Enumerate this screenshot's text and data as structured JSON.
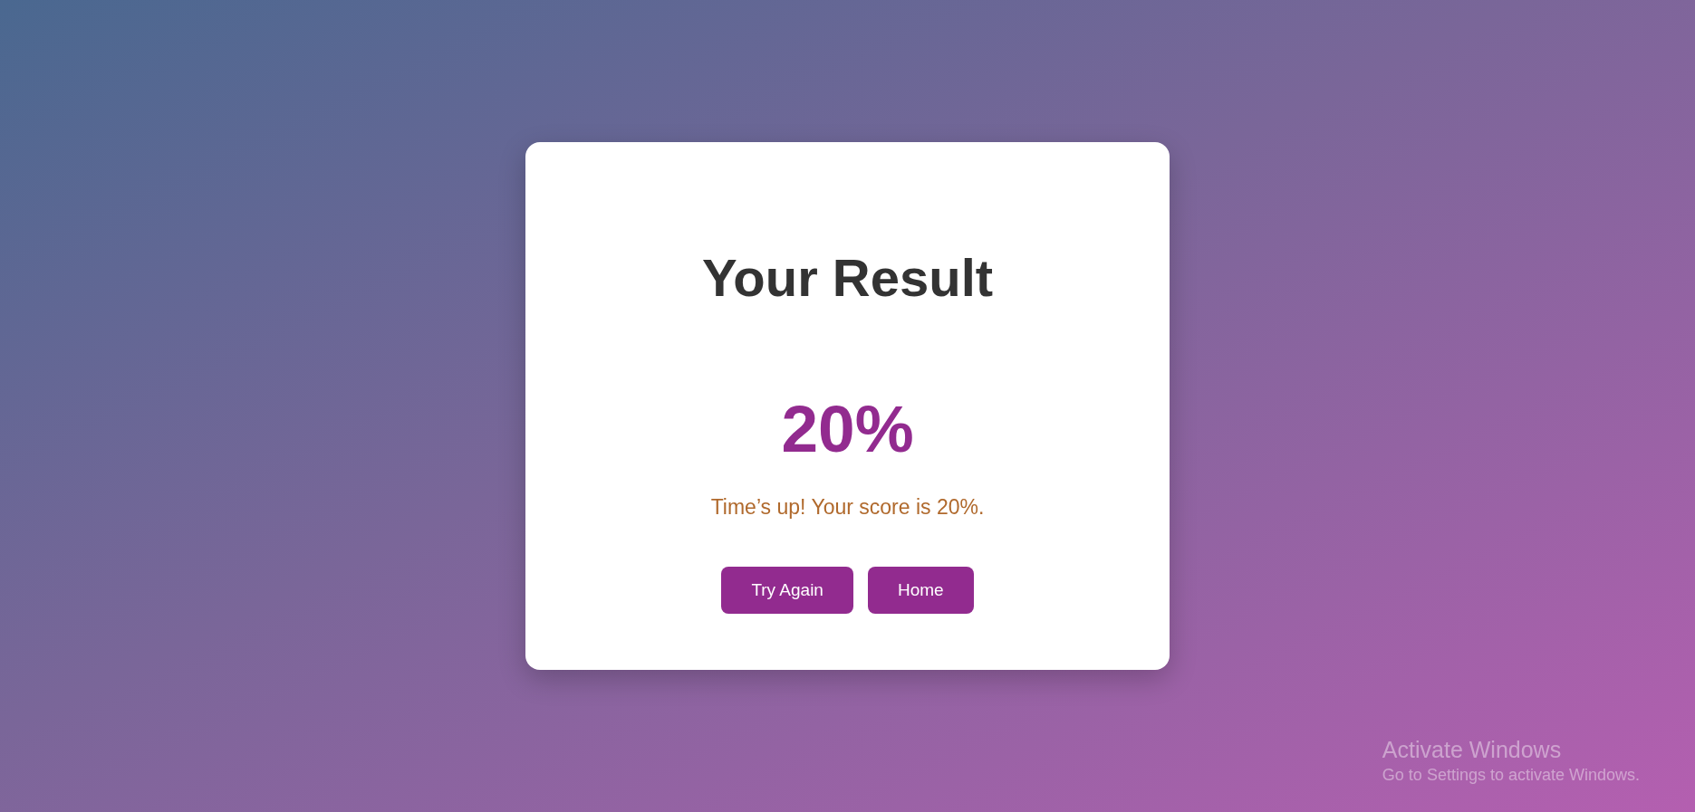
{
  "result_card": {
    "title": "Your Result",
    "score": "20%",
    "message": "Time’s up! Your score is 20%.",
    "buttons": [
      "Try Again",
      "Home"
    ]
  },
  "activation_notice": {
    "title": "Activate Windows",
    "message": "Go to Settings to activate Windows."
  }
}
